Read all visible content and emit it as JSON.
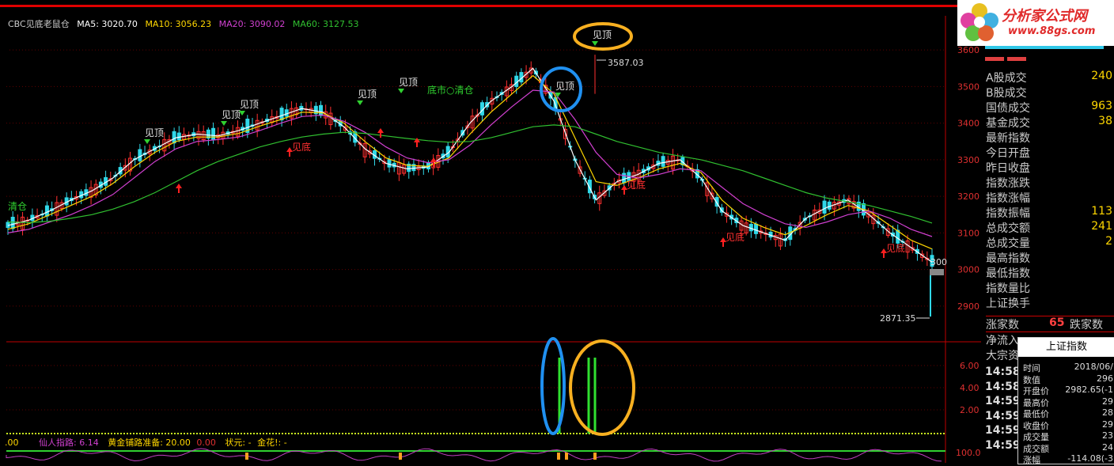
{
  "header": {
    "indicator_name": "CBC见底老鼠仓",
    "ma5": "MA5: 3020.70",
    "ma10": "MA10: 3056.23",
    "ma20": "MA20: 3090.02",
    "ma60": "MA60: 3127.53"
  },
  "logo": {
    "title": "分析家公式网",
    "url": "www.88gs.com"
  },
  "annotations": {
    "jianding": "见顶",
    "jiandi": "见底",
    "qingcang": "清仓",
    "dishi": "底市○清仓",
    "high_label": "3587.03",
    "low_label": "2871.35",
    "right_cut": "300"
  },
  "bottom_legend": {
    "prefix": ".00",
    "xianren": "仙人指路: 6.14",
    "huangjin": "黄金铺路准备: 20.00",
    "zero": "0.00",
    "zhuangyuan": "状元: -",
    "jinhua": "金花!: -"
  },
  "chart_data": {
    "type": "line",
    "title": "",
    "ylim": [
      2850,
      3650
    ],
    "y_ticks": [
      "3600",
      "3500",
      "3400",
      "3300",
      "3200",
      "3100",
      "3000",
      "2900"
    ],
    "sub_y_ticks": [
      "6.00",
      "4.00",
      "2.00"
    ],
    "sub2_tick": "100.0",
    "high": 3587.03,
    "low": 2871.35,
    "series": [
      {
        "name": "MA5",
        "color": "#ffffff",
        "values": [
          3120,
          3135,
          3160,
          3190,
          3215,
          3250,
          3300,
          3330,
          3360,
          3370,
          3365,
          3380,
          3400,
          3420,
          3440,
          3430,
          3390,
          3330,
          3290,
          3275,
          3280,
          3320,
          3400,
          3460,
          3500,
          3550,
          3460,
          3300,
          3190,
          3240,
          3260,
          3290,
          3300,
          3250,
          3160,
          3120,
          3100,
          3080,
          3140,
          3170,
          3190,
          3150,
          3100,
          3060,
          3020
        ]
      },
      {
        "name": "MA10",
        "color": "#ffd700",
        "values": [
          3110,
          3125,
          3150,
          3175,
          3200,
          3235,
          3280,
          3320,
          3350,
          3362,
          3362,
          3372,
          3392,
          3410,
          3430,
          3428,
          3400,
          3350,
          3305,
          3285,
          3282,
          3305,
          3370,
          3430,
          3480,
          3530,
          3480,
          3360,
          3240,
          3230,
          3250,
          3275,
          3290,
          3265,
          3190,
          3140,
          3115,
          3095,
          3120,
          3150,
          3175,
          3160,
          3120,
          3080,
          3056
        ]
      },
      {
        "name": "MA20",
        "color": "#d040d0",
        "values": [
          3100,
          3110,
          3130,
          3150,
          3175,
          3205,
          3250,
          3295,
          3330,
          3350,
          3355,
          3362,
          3380,
          3400,
          3418,
          3422,
          3405,
          3375,
          3335,
          3305,
          3292,
          3300,
          3340,
          3395,
          3445,
          3490,
          3485,
          3410,
          3320,
          3260,
          3250,
          3260,
          3275,
          3270,
          3225,
          3180,
          3150,
          3125,
          3115,
          3130,
          3150,
          3160,
          3140,
          3110,
          3090
        ]
      },
      {
        "name": "MA60",
        "color": "#30c030",
        "values": [
          3130,
          3128,
          3132,
          3140,
          3150,
          3165,
          3185,
          3210,
          3240,
          3270,
          3295,
          3315,
          3335,
          3350,
          3362,
          3370,
          3375,
          3372,
          3365,
          3358,
          3352,
          3348,
          3350,
          3360,
          3375,
          3390,
          3395,
          3390,
          3370,
          3350,
          3335,
          3320,
          3310,
          3300,
          3285,
          3270,
          3250,
          3230,
          3210,
          3195,
          3185,
          3175,
          3160,
          3145,
          3127
        ]
      }
    ]
  },
  "right_panel": {
    "rows": [
      {
        "label": "A股成交",
        "value": "240"
      },
      {
        "label": "B股成交",
        "value": ""
      },
      {
        "label": "国债成交",
        "value": "963"
      },
      {
        "label": "基金成交",
        "value": "38"
      },
      {
        "label": "最新指数",
        "value": ""
      },
      {
        "label": "今日开盘",
        "value": ""
      },
      {
        "label": "昨日收盘",
        "value": ""
      },
      {
        "label": "指数涨跌",
        "value": ""
      },
      {
        "label": "指数涨幅",
        "value": ""
      },
      {
        "label": "指数振幅",
        "value": "113"
      },
      {
        "label": "总成交额",
        "value": "241"
      },
      {
        "label": "总成交量",
        "value": "2"
      },
      {
        "label": "最高指数",
        "value": ""
      },
      {
        "label": "最低指数",
        "value": ""
      },
      {
        "label": "指数量比",
        "value": ""
      },
      {
        "label": "上证换手",
        "value": ""
      }
    ],
    "updown": {
      "label": "涨家数",
      "value": "65",
      "label2": "跌家数"
    },
    "net_flow": "净流入",
    "big_deal": "大宗资",
    "times": [
      "14:58",
      "14:58",
      "14:59",
      "14:59",
      "14:59",
      "14:59"
    ],
    "cut_header": "上证指数"
  },
  "popup": {
    "title": "上证指数",
    "rows": [
      {
        "label": "时间",
        "value": "2018/06/"
      },
      {
        "label": "数值",
        "value": "296"
      },
      {
        "label": "开盘价",
        "value": "2982.65(-1"
      },
      {
        "label": "最高价",
        "value": "29"
      },
      {
        "label": "最低价",
        "value": "28"
      },
      {
        "label": "收盘价",
        "value": "29"
      },
      {
        "label": "成交量",
        "value": "23"
      },
      {
        "label": "成交额",
        "value": "24"
      },
      {
        "label": "涨幅",
        "value": "-114.08(-3"
      }
    ]
  }
}
